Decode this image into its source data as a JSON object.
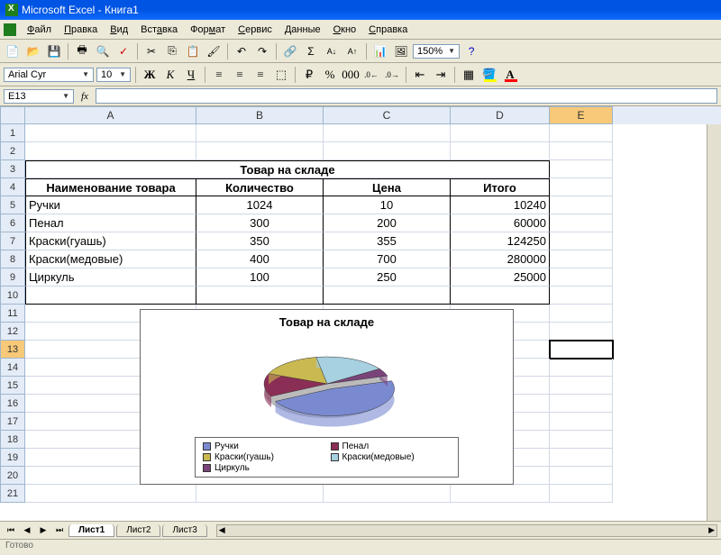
{
  "app": {
    "title": "Microsoft Excel - Книга1"
  },
  "menu": {
    "file": "Файл",
    "edit": "Правка",
    "view": "Вид",
    "insert": "Вставка",
    "format": "Формат",
    "tools": "Сервис",
    "data": "Данные",
    "window": "Окно",
    "help": "Справка"
  },
  "toolbar": {
    "zoom": "150%"
  },
  "format": {
    "font_name": "Arial Cyr",
    "font_size": "10"
  },
  "namebox": {
    "cell_ref": "E13"
  },
  "columns": [
    "A",
    "B",
    "C",
    "D",
    "E"
  ],
  "table": {
    "title": "Товар на складе",
    "headers": {
      "name": "Наименование товара",
      "qty": "Количество",
      "price": "Цена",
      "total": "Итого"
    },
    "rows": [
      {
        "name": "Ручки",
        "qty": "1024",
        "price": "10",
        "total": "10240"
      },
      {
        "name": "Пенал",
        "qty": "300",
        "price": "200",
        "total": "60000"
      },
      {
        "name": "Краски(гуашь)",
        "qty": "350",
        "price": "355",
        "total": "124250"
      },
      {
        "name": "Краски(медовые)",
        "qty": "400",
        "price": "700",
        "total": "280000"
      },
      {
        "name": "Циркуль",
        "qty": "100",
        "price": "250",
        "total": "25000"
      }
    ]
  },
  "chart_data": {
    "type": "pie",
    "title": "Товар на складе",
    "categories": [
      "Ручки",
      "Пенал",
      "Краски(гуашь)",
      "Краски(медовые)",
      "Циркуль"
    ],
    "values": [
      1024,
      300,
      350,
      400,
      100
    ],
    "colors": [
      "#7a8ad0",
      "#8b2e56",
      "#c9b950",
      "#a7d0e0",
      "#7a447a"
    ]
  },
  "sheets": {
    "active": "Лист1",
    "tabs": [
      "Лист1",
      "Лист2",
      "Лист3"
    ]
  },
  "status": "Готово"
}
